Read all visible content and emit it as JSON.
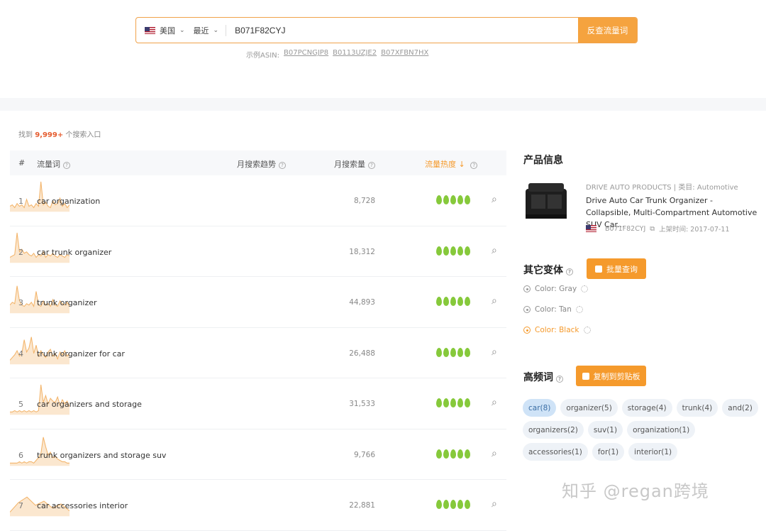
{
  "search": {
    "country": "美国",
    "period": "最近",
    "asin": "B071F82CYJ",
    "button": "反查流量词",
    "examples_label": "示例ASIN:",
    "examples": [
      "B07PCNGJP8",
      "B0113UZJE2",
      "B07XFBN7HX"
    ]
  },
  "results": {
    "prefix": "找到",
    "count": "9,999+",
    "suffix": "个搜索入口"
  },
  "table": {
    "headers": {
      "idx": "#",
      "keyword": "流量词",
      "trend": "月搜索趋势",
      "volume": "月搜索量",
      "heat": "流量热度"
    },
    "rows": [
      {
        "idx": "1",
        "keyword": "car organization",
        "volume": "8,728",
        "trend": [
          4,
          5,
          3,
          6,
          4,
          5,
          3,
          9,
          4,
          5,
          3,
          6,
          4,
          22,
          5,
          7,
          4,
          3,
          8,
          5,
          6,
          10,
          4,
          6,
          3,
          5
        ]
      },
      {
        "idx": "2",
        "keyword": "car trunk organizer",
        "volume": "18,312",
        "trend": [
          4,
          5,
          6,
          22,
          8,
          10,
          7,
          8,
          6,
          5,
          7,
          4,
          6,
          5,
          8,
          4,
          6,
          5,
          7,
          5,
          4,
          6,
          5,
          4,
          6,
          5
        ]
      },
      {
        "idx": "3",
        "keyword": "trunk organizer",
        "volume": "44,893",
        "trend": [
          6,
          8,
          7,
          20,
          9,
          6,
          5,
          7,
          6,
          8,
          5,
          16,
          6,
          5,
          9,
          6,
          7,
          5,
          10,
          6,
          5,
          9,
          7,
          6,
          8,
          5
        ]
      },
      {
        "idx": "4",
        "keyword": "trunk organizer for car",
        "volume": "26,488",
        "trend": [
          3,
          5,
          7,
          10,
          6,
          8,
          18,
          9,
          12,
          20,
          8,
          14,
          6,
          10,
          7,
          5,
          9,
          11,
          6,
          8,
          4,
          9,
          7,
          10,
          6,
          8
        ]
      },
      {
        "idx": "5",
        "keyword": "car organizers and storage",
        "volume": "31,533",
        "trend": [
          2,
          2,
          3,
          2,
          3,
          2,
          3,
          2,
          3,
          2,
          3,
          2,
          3,
          22,
          9,
          14,
          8,
          12,
          10,
          9,
          13,
          7,
          11,
          8,
          10,
          6
        ]
      },
      {
        "idx": "6",
        "keyword": "trunk organizers and storage suv",
        "volume": "9,766",
        "trend": [
          2,
          2,
          2,
          2,
          3,
          2,
          3,
          2,
          3,
          3,
          2,
          4,
          6,
          9,
          21,
          14,
          8,
          10,
          6,
          7,
          5,
          4,
          3,
          3,
          2,
          2
        ]
      },
      {
        "idx": "7",
        "keyword": "car accessories interior",
        "volume": "22,881",
        "trend": [
          3,
          10,
          14,
          8,
          11,
          6,
          9,
          4
        ]
      }
    ]
  },
  "product": {
    "section_title": "产品信息",
    "brand": "DRIVE AUTO PRODUCTS",
    "category": "类目: Automotive",
    "title": "Drive Auto Car Trunk Organizer - Collapsible, Multi-Compartment Automotive SUV Car...",
    "asin": "B071F82CYJ",
    "listed": "上架时间: 2017-07-11"
  },
  "variants": {
    "title": "其它变体",
    "button": "批量查询",
    "items": [
      {
        "label": "Color: Gray",
        "active": false
      },
      {
        "label": "Color: Tan",
        "active": false
      },
      {
        "label": "Color: Black",
        "active": true
      }
    ]
  },
  "hotwords": {
    "title": "高频词",
    "button": "复制到剪贴板",
    "tags": [
      "car(8)",
      "organizer(5)",
      "storage(4)",
      "trunk(4)",
      "and(2)",
      "organizers(2)",
      "suv(1)",
      "organization(1)",
      "accessories(1)",
      "for(1)",
      "interior(1)"
    ]
  },
  "watermark": "知乎 @regan跨境",
  "colors": {
    "accent": "#f59a2c",
    "heat": "#86c93b",
    "trend_fill": "#fbe7cf",
    "trend_line": "#f3b46a"
  }
}
